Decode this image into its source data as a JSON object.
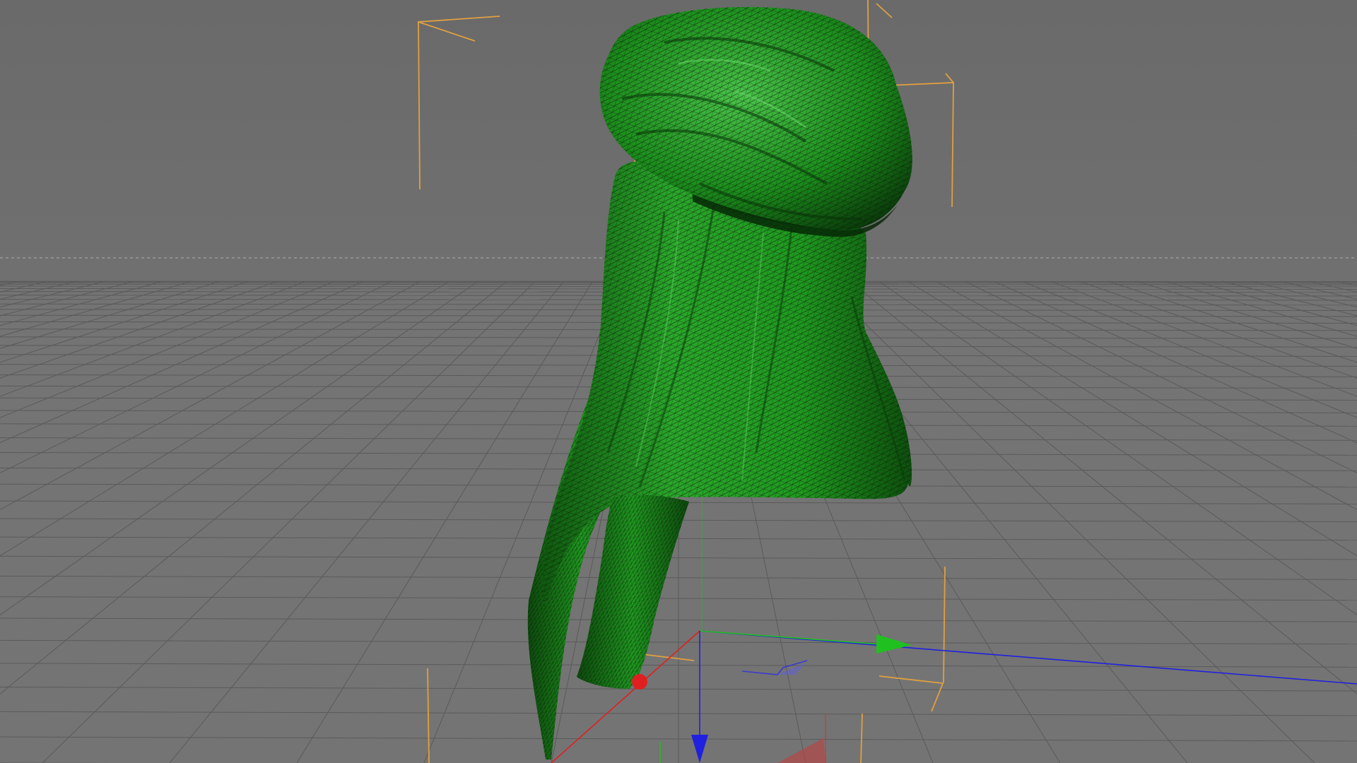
{
  "viewport": {
    "kind": "3d-perspective-viewport",
    "background_top": "#6a6a6a",
    "background_bottom": "#7a7a7a",
    "floor_color": "#727272",
    "grid_line_color": "#5a5a5a",
    "horizon_guide_color": "#9a9a9a"
  },
  "scene_object": {
    "name": "turban-cloth-mesh",
    "display_mode": "shaded-with-wireframe",
    "surface_color": "#1f9a1f",
    "surface_dark": "#0a3d0a",
    "surface_highlight": "#5fd25f",
    "wire_color": "#0b1a0b"
  },
  "bounding_box": {
    "color": "#e0a040"
  },
  "gizmo": {
    "x_axis_color": "#e02020",
    "y_axis_color": "#20c020",
    "z_axis_color": "#2020e0",
    "icons": [
      "move-gizmo-icon",
      "x-axis-handle-icon",
      "y-axis-handle-icon",
      "z-axis-handle-icon"
    ]
  }
}
